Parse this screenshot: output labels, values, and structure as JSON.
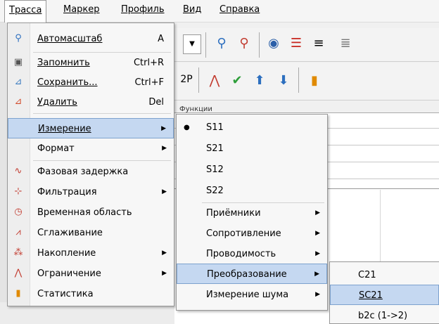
{
  "menubar": {
    "items": [
      {
        "label": "Трасса"
      },
      {
        "label": "Маркер"
      },
      {
        "label": "Профиль"
      },
      {
        "label": "Вид"
      },
      {
        "label": "Справка"
      }
    ]
  },
  "toolbar": {
    "functions_label": "Функции"
  },
  "menu_trace": {
    "items": [
      {
        "label": "Автомасштаб",
        "shortcut": "A",
        "icon": "autoscale-icon"
      },
      {
        "label": "Запомнить",
        "shortcut": "Ctrl+R",
        "icon": "memory-icon"
      },
      {
        "label": "Сохранить...",
        "shortcut": "Ctrl+F",
        "icon": "save-trace-icon"
      },
      {
        "label": "Удалить",
        "shortcut": "Del",
        "icon": "delete-trace-icon"
      },
      {
        "label": "Измерение"
      },
      {
        "label": "Формат"
      },
      {
        "label": "Фазовая задержка",
        "icon": "phase-delay-icon"
      },
      {
        "label": "Фильтрация",
        "icon": "filter-icon"
      },
      {
        "label": "Временная область",
        "icon": "time-domain-icon"
      },
      {
        "label": "Сглаживание",
        "icon": "smoothing-icon"
      },
      {
        "label": "Накопление",
        "icon": "accumulation-icon"
      },
      {
        "label": "Ограничение",
        "icon": "limit-icon"
      },
      {
        "label": "Статистика",
        "icon": "statistics-icon"
      }
    ]
  },
  "menu_measure": {
    "items": [
      {
        "label": "S11"
      },
      {
        "label": "S21"
      },
      {
        "label": "S12"
      },
      {
        "label": "S22"
      },
      {
        "label": "Приёмники"
      },
      {
        "label": "Сопротивление"
      },
      {
        "label": "Проводимость"
      },
      {
        "label": "Преобразование"
      },
      {
        "label": "Измерение шума"
      }
    ]
  },
  "menu_transform": {
    "items": [
      {
        "label": "C21"
      },
      {
        "label": "SC21"
      },
      {
        "label": "b2c (1->2)"
      }
    ]
  },
  "colors": {
    "highlight": "#c5d8f1",
    "highlight_border": "#7da2ce"
  }
}
